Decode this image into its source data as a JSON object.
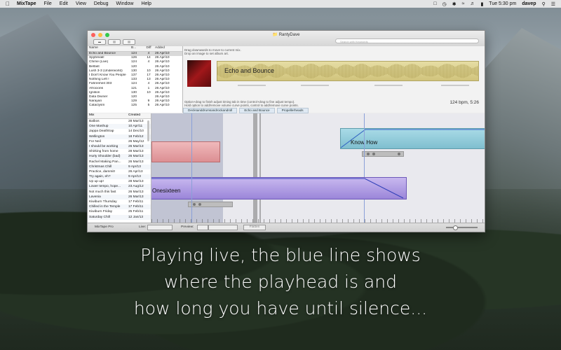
{
  "menubar": {
    "app_name": "MixTape",
    "items": [
      "File",
      "Edit",
      "View",
      "Debug",
      "Window",
      "Help"
    ],
    "time": "Tue 5:30 pm",
    "user": "davep"
  },
  "window": {
    "title": "RantyDave",
    "search_placeholder": "Search with Keywords",
    "library": {
      "columns": [
        "Name",
        "B...",
        "Diff",
        "Added"
      ],
      "rows": [
        {
          "name": "Echo and Bounce",
          "b": "124",
          "diff": "4",
          "added": "26 Apr/10",
          "selected": true
        },
        {
          "name": "Spybreak!",
          "b": "126",
          "diff": "14",
          "added": "26 Apr/10"
        },
        {
          "name": "Chime (Live)",
          "b": "124",
          "diff": "4",
          "added": "26 Apr/10"
        },
        {
          "name": "Belfast",
          "b": "120",
          "diff": "",
          "added": "26 Apr/10"
        },
        {
          "name": "Lush 3-3 (Underworld)",
          "b": "130",
          "diff": "10",
          "added": "26 Apr/10"
        },
        {
          "name": "I Don't Know You People",
          "b": "137",
          "diff": "17",
          "added": "26 Apr/10"
        },
        {
          "name": "Nothing Left !",
          "b": "133",
          "diff": "13",
          "added": "26 Apr/10"
        },
        {
          "name": "Fahrenheit 303",
          "b": "124",
          "diff": "4",
          "added": "26 Apr/10"
        },
        {
          "name": "Afrocionk",
          "b": "121",
          "diff": "1",
          "added": "26 Apr/10"
        },
        {
          "name": "Ignition",
          "b": "130",
          "diff": "10",
          "added": "26 Apr/10"
        },
        {
          "name": "Data Diviner",
          "b": "120",
          "diff": "",
          "added": "26 Apr/10"
        },
        {
          "name": "Narayan",
          "b": "129",
          "diff": "9",
          "added": "26 Apr/10"
        },
        {
          "name": "Cataclysm",
          "b": "125",
          "diff": "5",
          "added": "26 Apr/10"
        }
      ]
    },
    "info": {
      "hint_top": "Drag downwards to move to current mix.\nDrop an image to set album art.",
      "track_title": "Echo and Bounce",
      "bpm_length": "124 bpm, 5:26",
      "hint_bottom": "Option+drag to finish adjust timing tab in time (control+drag to fine adjust tempo).\nHold option to add/remove volume curve points, control to add/remove curve points.",
      "tabs": [
        "Decksanddrumsandrockandroll",
        "Echo and Bounce",
        "Propellerheads"
      ]
    },
    "mixes": {
      "columns": [
        "Mix",
        "Created"
      ],
      "rows": [
        {
          "name": "Balbos",
          "date": "28 Mar/13"
        },
        {
          "name": "One Mashup",
          "date": "10 Apr/11"
        },
        {
          "name": "Jappa Deathtrap",
          "date": "14 Dec/10"
        },
        {
          "name": "Wellington",
          "date": "18 Feb/12"
        },
        {
          "name": "For Neil",
          "date": "26 May/12"
        },
        {
          "name": "I should be working",
          "date": "26 Mar/13"
        },
        {
          "name": "Shirking from home",
          "date": "28 Mar/13"
        },
        {
          "name": "Hurty Shoulder (bad)",
          "date": "26 Mar/13"
        },
        {
          "name": "Rachel Making Pan...",
          "date": "26 Mar/13"
        },
        {
          "name": "Christmas Chill",
          "date": "9 Apr/13"
        },
        {
          "name": "Practice, dammit!",
          "date": "26 Apr/13"
        },
        {
          "name": "Try again, eh?",
          "date": "9 Apr/13"
        },
        {
          "name": "Up up up!",
          "date": "28 Mar/13"
        },
        {
          "name": "Lower tempo, hope...",
          "date": "23 Aug/12"
        },
        {
          "name": "Not much this fast",
          "date": "26 Mar/13"
        },
        {
          "name": "Lavenia",
          "date": "26 Mar/13"
        },
        {
          "name": "Kiwiburn Thursday",
          "date": "17 Feb/11"
        },
        {
          "name": "Chilled in the Temple",
          "date": "17 Feb/11"
        },
        {
          "name": "Kiwiburn Friday",
          "date": "25 Feb/11"
        },
        {
          "name": "Saturday Chill",
          "date": "12 Jan/13"
        }
      ]
    },
    "timeline": {
      "tracks": [
        {
          "label": "Know How",
          "color": "#9ed0dd"
        },
        {
          "label": "Onesixteen",
          "color": "#b8a6e6"
        },
        {
          "label": "",
          "color": "#e6a3a6"
        }
      ]
    },
    "statusbar": {
      "app_label": "MixTape Pro",
      "live_label": "Live:",
      "preview_label": "Preview:",
      "button": "Flatten"
    }
  },
  "caption": {
    "line1": "Playing live, the blue line shows",
    "line2": "where the playhead is and",
    "line3": "how long you have until silence..."
  }
}
